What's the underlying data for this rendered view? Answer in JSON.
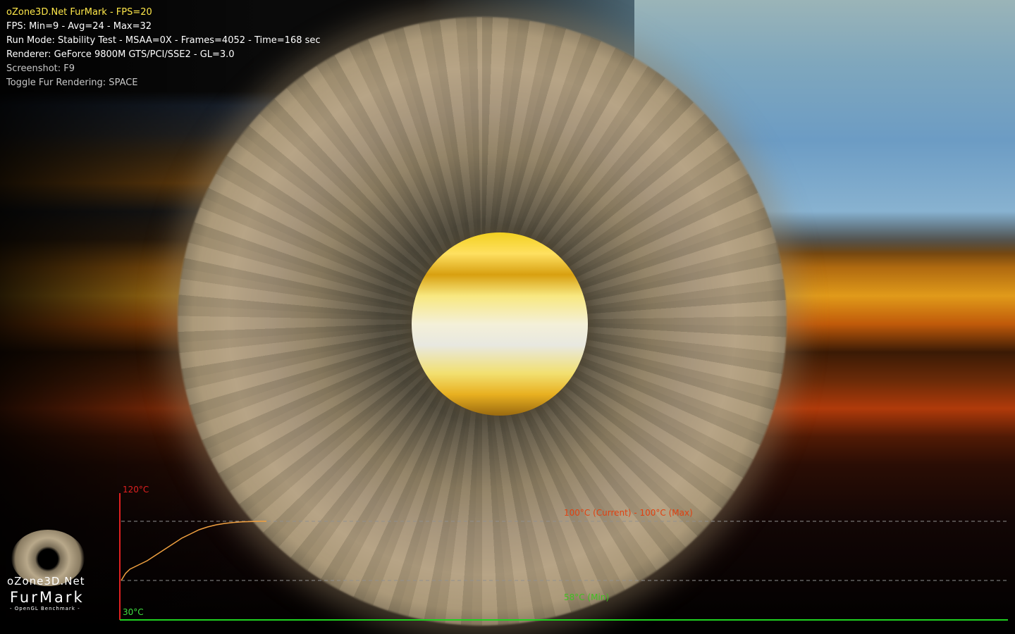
{
  "hud": {
    "title": "oZone3D.Net FurMark - FPS=20",
    "fps_stats": "FPS: Min=9 - Avg=24 - Max=32",
    "run_mode": "Run Mode: Stability Test - MSAA=0X - Frames=4052 - Time=168 sec",
    "renderer": "Renderer: GeForce 9800M GTS/PCI/SSE2 - GL=3.0",
    "screenshot_hint": "Screenshot: F9",
    "toggle_hint": "Toggle Fur Rendering: SPACE"
  },
  "logo": {
    "site": "oZone3D.Net",
    "name": "FurMark",
    "subtitle": "- OpenGL Benchmark -"
  },
  "temperature_graph": {
    "y_max_label": "120°C",
    "y_min_label": "30°C",
    "current_max_label": "100°C (Current) - 100°C (Max)",
    "min_label": "58°C (Min)",
    "colors": {
      "axis_y": "#e02020",
      "axis_x": "#20d020",
      "curve": "#f0a040",
      "current_label": "#e04010",
      "min_label": "#40c020",
      "max_axis_label": "#e02020",
      "min_axis_label": "#40e040",
      "guide": "#909090"
    }
  },
  "chart_data": {
    "type": "line",
    "ylim": [
      30,
      120
    ],
    "x": [
      0,
      5,
      10,
      20,
      30,
      40,
      50,
      60,
      70,
      80,
      90,
      100,
      110,
      120,
      130,
      140,
      150,
      160,
      168
    ],
    "series": [
      {
        "values": [
          58,
          63,
          66,
          69,
          72,
          76,
          80,
          84,
          88,
          91,
          94,
          96,
          97.5,
          98.5,
          99.2,
          99.6,
          99.8,
          100,
          100
        ]
      }
    ],
    "max_reference": 100,
    "min_reference": 58
  }
}
